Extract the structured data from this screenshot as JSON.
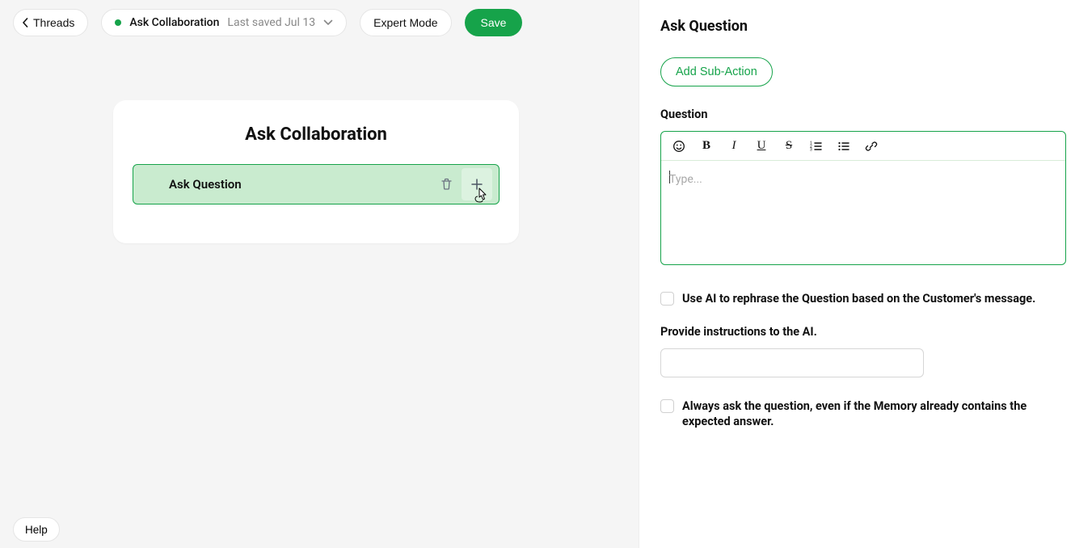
{
  "header": {
    "back_label": "Threads",
    "project_name": "Ask Collaboration",
    "saved_text": "Last saved Jul 13",
    "expert_label": "Expert Mode",
    "save_label": "Save"
  },
  "canvas": {
    "title": "Ask Collaboration",
    "action_label": "Ask Question"
  },
  "panel": {
    "title": "Ask Question",
    "add_sub_label": "Add Sub-Action",
    "question_label": "Question",
    "question_placeholder": "Type...",
    "ai_rephrase_label": "Use AI to rephrase the Question based on the Customer's message.",
    "instructions_label": "Provide instructions to the AI.",
    "instructions_value": "",
    "always_ask_label": "Always ask the question, even if the Memory already contains the expected answer."
  },
  "help_label": "Help"
}
